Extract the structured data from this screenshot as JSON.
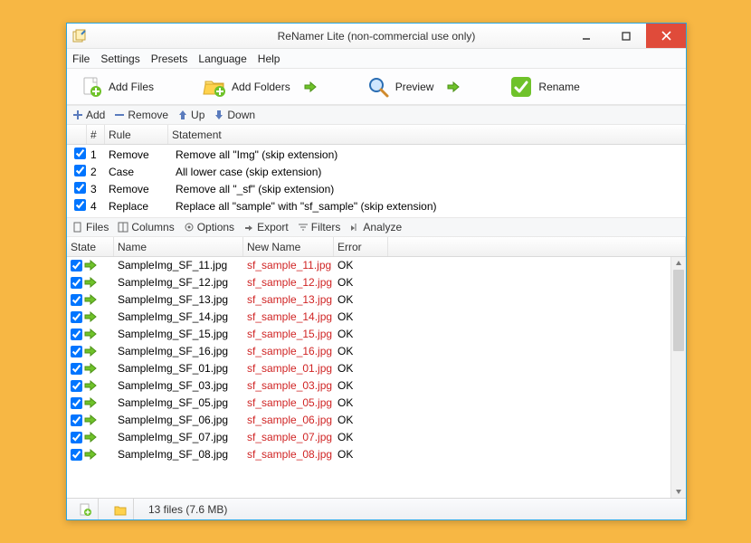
{
  "window": {
    "title": "ReNamer Lite (non-commercial use only)"
  },
  "menubar": [
    "File",
    "Settings",
    "Presets",
    "Language",
    "Help"
  ],
  "toolbar": {
    "add_files": "Add Files",
    "add_folders": "Add Folders",
    "preview": "Preview",
    "rename": "Rename"
  },
  "rules_toolbar": {
    "add": "Add",
    "remove": "Remove",
    "up": "Up",
    "down": "Down"
  },
  "rules_header": {
    "num": "#",
    "rule": "Rule",
    "stmt": "Statement"
  },
  "rules": [
    {
      "n": "1",
      "rule": "Remove",
      "stmt": "Remove all \"Img\" (skip extension)"
    },
    {
      "n": "2",
      "rule": "Case",
      "stmt": "All lower case (skip extension)"
    },
    {
      "n": "3",
      "rule": "Remove",
      "stmt": "Remove all \"_sf\" (skip extension)"
    },
    {
      "n": "4",
      "rule": "Replace",
      "stmt": "Replace all \"sample\" with \"sf_sample\" (skip extension)"
    }
  ],
  "files_toolbar": [
    "Files",
    "Columns",
    "Options",
    "Export",
    "Filters",
    "Analyze"
  ],
  "files_header": {
    "state": "State",
    "name": "Name",
    "newname": "New Name",
    "error": "Error"
  },
  "files": [
    {
      "name": "SampleImg_SF_11.jpg",
      "newname": "sf_sample_11.jpg",
      "err": "OK"
    },
    {
      "name": "SampleImg_SF_12.jpg",
      "newname": "sf_sample_12.jpg",
      "err": "OK"
    },
    {
      "name": "SampleImg_SF_13.jpg",
      "newname": "sf_sample_13.jpg",
      "err": "OK"
    },
    {
      "name": "SampleImg_SF_14.jpg",
      "newname": "sf_sample_14.jpg",
      "err": "OK"
    },
    {
      "name": "SampleImg_SF_15.jpg",
      "newname": "sf_sample_15.jpg",
      "err": "OK"
    },
    {
      "name": "SampleImg_SF_16.jpg",
      "newname": "sf_sample_16.jpg",
      "err": "OK"
    },
    {
      "name": "SampleImg_SF_01.jpg",
      "newname": "sf_sample_01.jpg",
      "err": "OK"
    },
    {
      "name": "SampleImg_SF_03.jpg",
      "newname": "sf_sample_03.jpg",
      "err": "OK"
    },
    {
      "name": "SampleImg_SF_05.jpg",
      "newname": "sf_sample_05.jpg",
      "err": "OK"
    },
    {
      "name": "SampleImg_SF_06.jpg",
      "newname": "sf_sample_06.jpg",
      "err": "OK"
    },
    {
      "name": "SampleImg_SF_07.jpg",
      "newname": "sf_sample_07.jpg",
      "err": "OK"
    },
    {
      "name": "SampleImg_SF_08.jpg",
      "newname": "sf_sample_08.jpg",
      "err": "OK"
    }
  ],
  "status": {
    "count": "13 files (7.6 MB)"
  }
}
